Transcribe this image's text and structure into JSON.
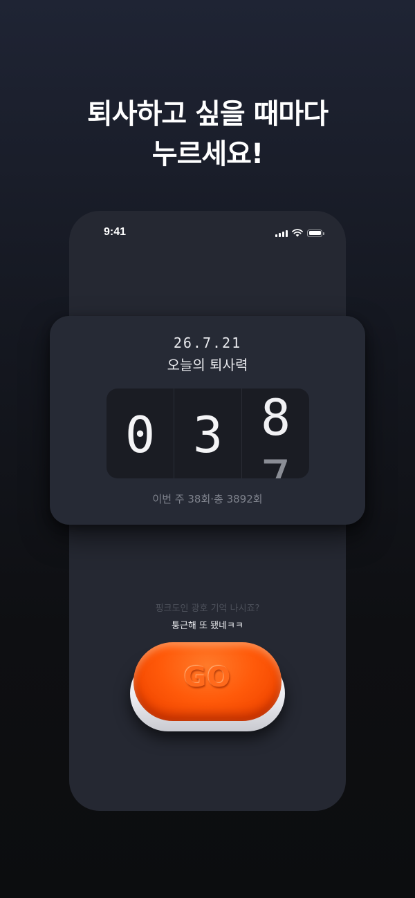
{
  "headline": {
    "line1": "퇴사하고 싶을 때마다",
    "line2": "누르세요!"
  },
  "status_bar": {
    "time": "9:41",
    "icons": [
      "signal-icon",
      "wifi-icon",
      "battery-icon"
    ]
  },
  "card": {
    "date": "26.7.21",
    "title": "오늘의 퇴사력",
    "counter": {
      "digits": [
        "0",
        "3",
        "8"
      ],
      "rolling_next": "7"
    },
    "stats": "이번 주 38회·총 3892회"
  },
  "hints": {
    "muted": "핑크도인 광호 기억 나시죠?",
    "main": "퉁근해 또 됐네ㅋㅋ"
  },
  "go_button": {
    "label": "GO"
  },
  "colors": {
    "accent": "#ff5a0a",
    "card_bg": "#262a35",
    "phone_bg": "#252832"
  }
}
